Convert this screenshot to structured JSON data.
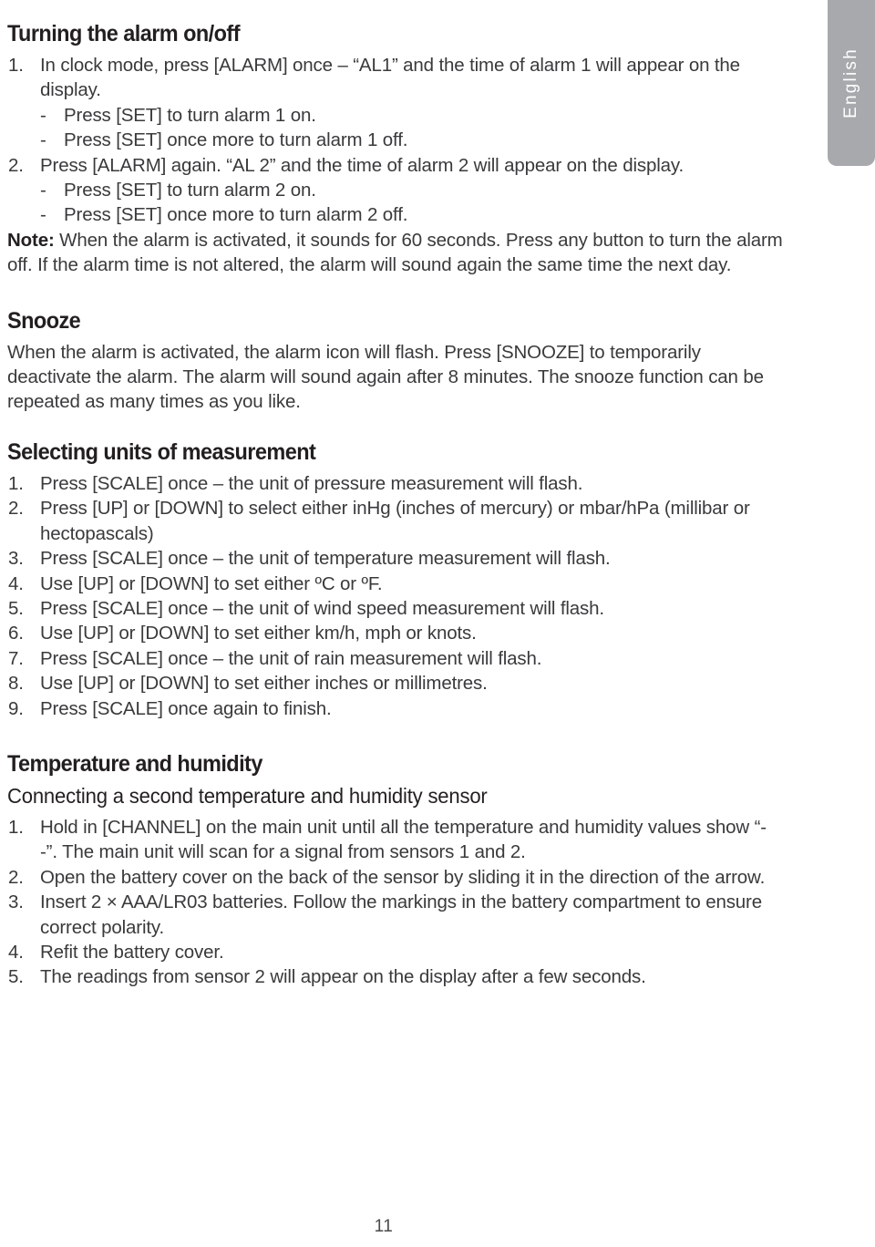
{
  "page": {
    "number": "11",
    "language_tab": "English"
  },
  "sections": [
    {
      "heading": "Turning the alarm on/off",
      "items": [
        {
          "num": "1.",
          "text": "In clock mode, press [ALARM] once – “AL1” and the time of alarm 1 will appear on the display."
        }
      ],
      "subitems_1": [
        {
          "dash": "-",
          "text": "Press [SET] to turn alarm 1 on."
        },
        {
          "dash": "-",
          "text": "Press [SET] once more to turn alarm 1 off."
        }
      ],
      "items_2": [
        {
          "num": "2.",
          "text": "Press [ALARM] again. “AL 2” and the time of alarm 2 will appear on the display."
        }
      ],
      "subitems_2": [
        {
          "dash": "-",
          "text": "Press [SET] to turn alarm 2 on."
        },
        {
          "dash": "-",
          "text": "Press [SET] once more to turn alarm 2 off."
        }
      ],
      "note_label": "Note:",
      "note_text": " When the alarm is activated, it sounds for 60 seconds. Press any button to turn the alarm off. If the alarm time is not altered, the alarm will sound again the same time the next day."
    },
    {
      "heading": "Snooze",
      "paragraph": "When the alarm is activated, the alarm icon will flash. Press [SNOOZE] to temporarily deactivate the alarm. The alarm will sound again after 8 minutes. The snooze function can be repeated as many times as you like."
    },
    {
      "heading": "Selecting units of measurement",
      "items": [
        {
          "num": "1.",
          "text": "Press [SCALE] once – the unit of pressure measurement will flash."
        },
        {
          "num": "2.",
          "text": "Press [UP] or [DOWN] to select either inHg (inches of mercury) or mbar/hPa (millibar or hectopascals)"
        },
        {
          "num": "3.",
          "text": "Press [SCALE] once – the unit of temperature measurement will flash."
        },
        {
          "num": "4.",
          "text": "Use [UP] or [DOWN] to set either ºC or ºF."
        },
        {
          "num": "5.",
          "text": "Press [SCALE] once – the unit of wind speed measurement will flash."
        },
        {
          "num": "6.",
          "text": "Use [UP] or [DOWN] to set either km/h, mph or knots."
        },
        {
          "num": "7.",
          "text": "Press [SCALE] once – the unit of rain measurement will flash."
        },
        {
          "num": "8.",
          "text": "Use [UP] or [DOWN] to set either inches or millimetres."
        },
        {
          "num": "9.",
          "text": "Press [SCALE] once again to finish."
        }
      ]
    },
    {
      "heading": "Temperature and humidity",
      "subheading": "Connecting a second temperature and humidity sensor",
      "items": [
        {
          "num": "1.",
          "text": "Hold in [CHANNEL] on the main unit until all the temperature and humidity values show “- -”. The main unit will scan for a signal from sensors 1 and 2."
        },
        {
          "num": "2.",
          "text": "Open the battery cover on the back of the sensor by sliding it in the direction of the arrow."
        },
        {
          "num": "3.",
          "text": "Insert 2 × AAA/LR03 batteries. Follow the markings in the battery compartment to ensure correct polarity."
        },
        {
          "num": "4.",
          "text": "Refit the battery cover."
        },
        {
          "num": "5.",
          "text": "The readings from sensor 2 will appear on the display after a few seconds."
        }
      ]
    }
  ]
}
